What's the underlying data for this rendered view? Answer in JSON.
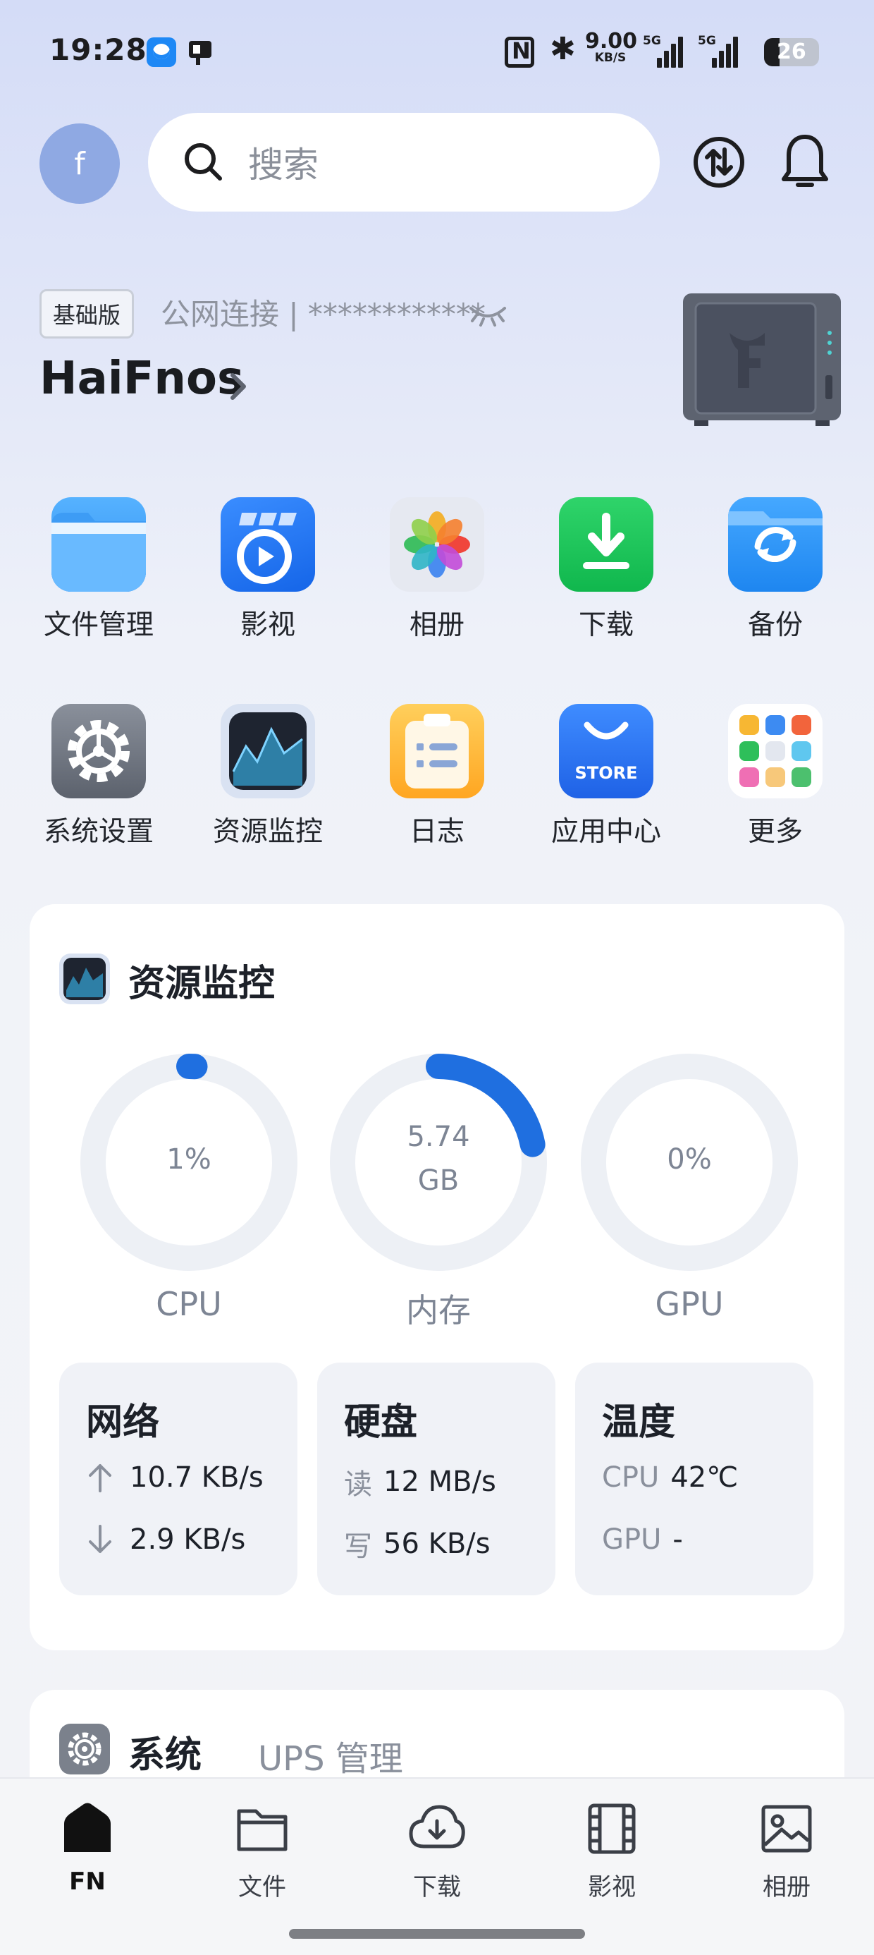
{
  "status_bar": {
    "time": "19:28",
    "speed_value": "9.00",
    "speed_unit": "KB/S",
    "sim1_label": "5G",
    "sim2_label": "5G",
    "battery": "26"
  },
  "top_bar": {
    "avatar_letter": "f",
    "search_placeholder": "搜索"
  },
  "device": {
    "edition_badge": "基础版",
    "connection_text": "公网连接 | ************",
    "name": "HaiFnos"
  },
  "apps": [
    {
      "label": "文件管理",
      "icon": "folder-icon"
    },
    {
      "label": "影视",
      "icon": "video-icon"
    },
    {
      "label": "相册",
      "icon": "photos-icon"
    },
    {
      "label": "下载",
      "icon": "download-icon"
    },
    {
      "label": "备份",
      "icon": "backup-icon"
    },
    {
      "label": "系统设置",
      "icon": "gear-icon"
    },
    {
      "label": "资源监控",
      "icon": "monitor-icon"
    },
    {
      "label": "日志",
      "icon": "log-icon"
    },
    {
      "label": "应用中心",
      "icon": "store-icon"
    },
    {
      "label": "更多",
      "icon": "more-grid-icon"
    }
  ],
  "store_text": "STORE",
  "monitor": {
    "title": "资源监控",
    "gauges": [
      {
        "label": "CPU",
        "value": "1%",
        "percent": 1
      },
      {
        "label": "内存",
        "value": "5.74",
        "unit": "GB",
        "percent": 22
      },
      {
        "label": "GPU",
        "value": "0%",
        "percent": 0
      }
    ],
    "network": {
      "title": "网络",
      "up": "10.7 KB/s",
      "down": "2.9 KB/s"
    },
    "disk": {
      "title": "硬盘",
      "read_key": "读",
      "read": "12 MB/s",
      "write_key": "写",
      "write": "56 KB/s"
    },
    "temperature": {
      "title": "温度",
      "cpu_key": "CPU",
      "cpu": "42℃",
      "gpu_key": "GPU",
      "gpu": "-"
    }
  },
  "system_card": {
    "title": "系统",
    "subtitle": "UPS 管理"
  },
  "bottom_nav": [
    {
      "label": "FN",
      "active": true
    },
    {
      "label": "文件",
      "active": false
    },
    {
      "label": "下载",
      "active": false
    },
    {
      "label": "影视",
      "active": false
    },
    {
      "label": "相册",
      "active": false
    }
  ],
  "colors": {
    "accent": "#1f6fe0",
    "gauge_track": "#edf0f5"
  }
}
